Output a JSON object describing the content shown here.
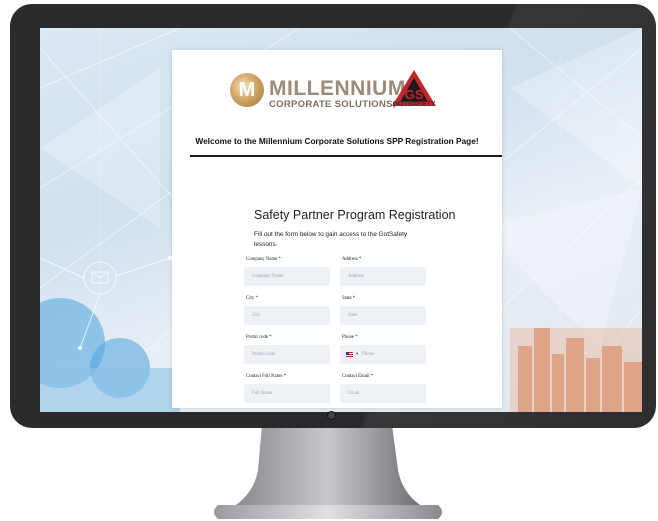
{
  "brand": {
    "monogram": "M",
    "name_line1": "MILLENNIUM",
    "name_line2": "CORPORATE SOLUTIONS,"
  },
  "partner_logo": {
    "letters": "GS",
    "name": "GOTSAFETY"
  },
  "welcome": "Welcome to the Millennium Corporate Solutions SPP Registration Page!",
  "form": {
    "title": "Safety Partner Program Registration",
    "description": "Fill out the form below to gain access to the GotSafety lessons.",
    "fields": {
      "company_name": {
        "label": "Company Name *",
        "placeholder": "Company Name"
      },
      "address": {
        "label": "Address *",
        "placeholder": "Address"
      },
      "city": {
        "label": "City *",
        "placeholder": "City"
      },
      "state": {
        "label": "State *",
        "placeholder": "State"
      },
      "postal_code": {
        "label": "Postal code *",
        "placeholder": "Postal Code"
      },
      "phone": {
        "label": "Phone *",
        "placeholder": "Phone",
        "country": "US"
      },
      "contact_full_name": {
        "label": "Contact Full Name *",
        "placeholder": "Full Name"
      },
      "contact_email": {
        "label": "Contact Email *",
        "placeholder": "Email"
      }
    }
  },
  "colors": {
    "bezel": "#2a2a2c",
    "input_bg": "#eef2f6",
    "brand_text": "#9b8b78",
    "gs_red": "#c0272d"
  }
}
